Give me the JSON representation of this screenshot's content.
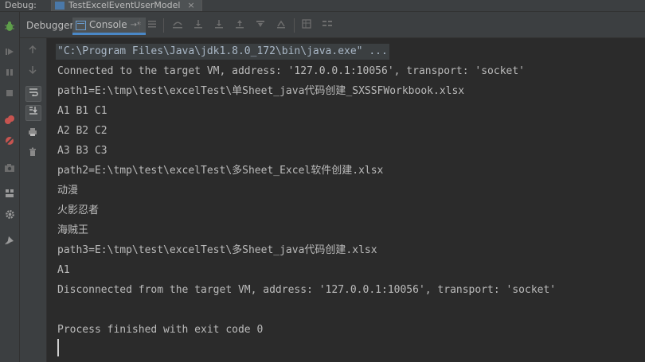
{
  "window": {
    "debug_label": "Debug:",
    "run_tab": "TestExcelEventUserModel",
    "close_glyph": "×"
  },
  "toolbar": {
    "tabs": [
      {
        "label": "Debugger"
      },
      {
        "label": "Console",
        "pin": "→*"
      }
    ]
  },
  "console": {
    "lines": [
      "\"C:\\Program Files\\Java\\jdk1.8.0_172\\bin\\java.exe\" ...",
      "Connected to the target VM, address: '127.0.0.1:10056', transport: 'socket'",
      "path1=E:\\tmp\\test\\excelTest\\单Sheet_java代码创建_SXSSFWorkbook.xlsx",
      "A1 B1 C1",
      "A2 B2 C2",
      "A3 B3 C3",
      "path2=E:\\tmp\\test\\excelTest\\多Sheet_Excel软件创建.xlsx",
      "动漫",
      "火影忍者",
      "海贼王",
      "path3=E:\\tmp\\test\\excelTest\\多Sheet_java代码创建.xlsx",
      "A1",
      "Disconnected from the target VM, address: '127.0.0.1:10056', transport: 'socket'",
      "",
      "Process finished with exit code 0"
    ]
  },
  "colors": {
    "background": "#2b2b2b",
    "panel": "#3c3f41",
    "accent": "#4a88c7",
    "text": "#bbbbbb"
  },
  "icons": {
    "left_bar": [
      "bug-icon",
      "rerun-icon",
      "resume-icon",
      "pause-icon",
      "stop-icon",
      "view-breakpoints-icon",
      "mute-breakpoints-icon",
      "camera-icon",
      "layout-icon",
      "settings-icon",
      "pin-icon"
    ],
    "console_gutter": [
      "up-arrow-icon",
      "down-arrow-icon",
      "soft-wrap-icon",
      "scroll-to-end-icon",
      "print-icon",
      "trash-icon"
    ],
    "toolbar": [
      "menu-icon",
      "step-over-icon",
      "step-into-icon",
      "force-step-into-icon",
      "step-out-icon",
      "drop-frame-icon",
      "run-to-cursor-icon",
      "evaluate-icon",
      "trace-icon"
    ]
  }
}
